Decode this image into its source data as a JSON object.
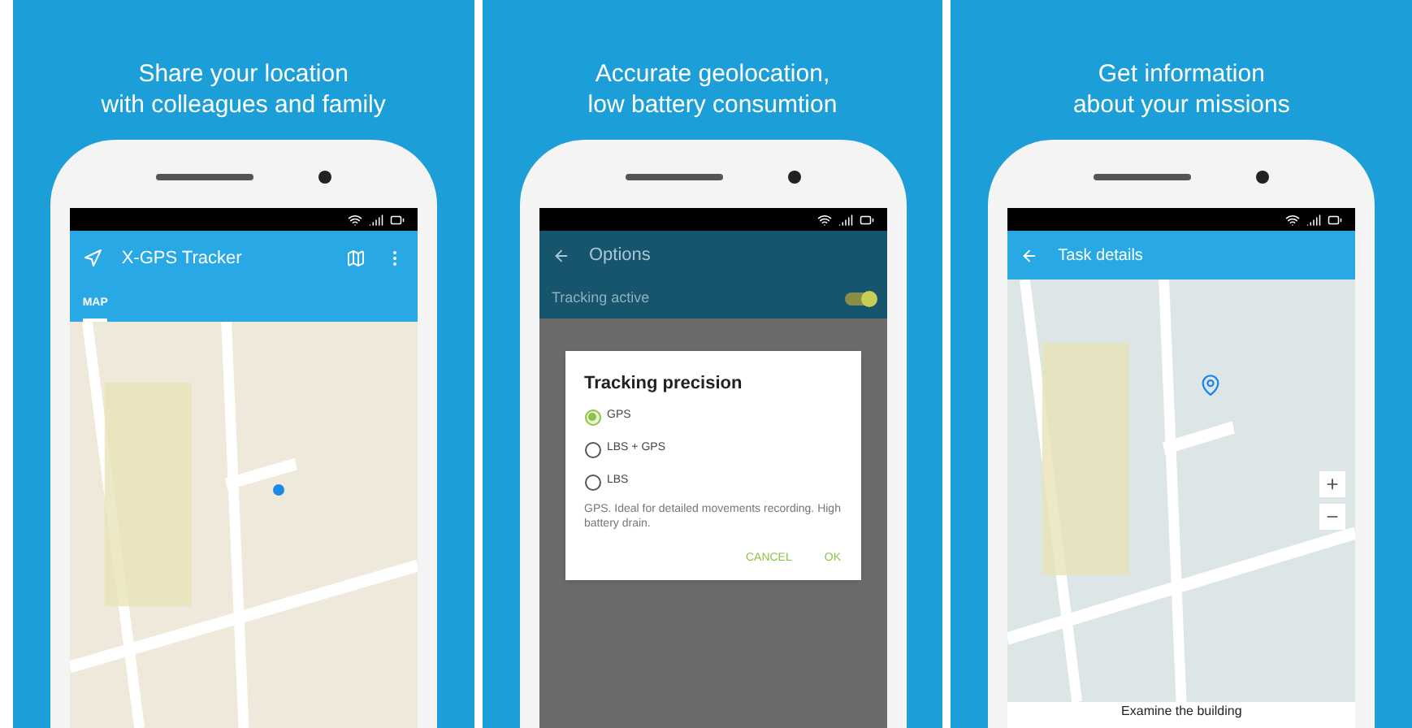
{
  "panels": [
    {
      "kind": "tracker",
      "headline": [
        "Share your location",
        "with colleagues and family"
      ],
      "app_title": "X-GPS Tracker",
      "tabs": [
        {
          "label": "MAP",
          "selected": true
        }
      ]
    },
    {
      "kind": "options",
      "headline": [
        "Accurate geolocation,",
        "low battery consumtion"
      ],
      "screen_title": "Options",
      "setting": {
        "label": "Tracking active",
        "on": true
      },
      "dialog": {
        "title": "Tracking precision",
        "options": [
          {
            "label": "GPS",
            "selected": true
          },
          {
            "label": "LBS + GPS",
            "selected": false
          },
          {
            "label": "LBS",
            "selected": false
          }
        ],
        "description": "GPS. Ideal for detailed movements recording. High battery drain.",
        "buttons": [
          "CANCEL",
          "OK"
        ]
      }
    },
    {
      "kind": "task",
      "headline": [
        "Get information",
        "about your missions"
      ],
      "screen_title": "Task details",
      "task": "Examine the building"
    }
  ]
}
